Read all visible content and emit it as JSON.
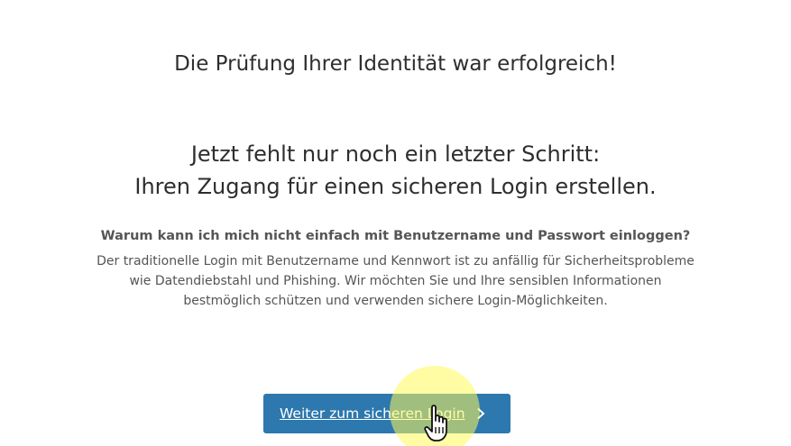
{
  "success": {
    "title": "Die Prüfung Ihrer Identität war erfolgreich!"
  },
  "step": {
    "line1": "Jetzt fehlt nur noch ein letzter Schritt:",
    "line2": "Ihren Zugang für einen sicheren Login erstellen."
  },
  "faq": {
    "question": "Warum kann ich mich nicht einfach mit Benutzername und Passwort einloggen?",
    "answer_lines": [
      "Der traditionelle Login mit Benutzername und Kennwort ist zu anfällig für Sicherheitsprobleme",
      "wie Datendiebstahl und Phishing. Wir möchten Sie und Ihre sensiblen Informationen",
      "bestmöglich schützen und verwenden sichere Login-Möglichkeiten."
    ]
  },
  "cta": {
    "label": "Weiter zum sicheren Login",
    "icon": "chevron-right-icon"
  },
  "cursor": {
    "icon": "hand-pointer-icon"
  },
  "colors": {
    "button": "#2d78ae",
    "highlight": "#fffa5a"
  }
}
